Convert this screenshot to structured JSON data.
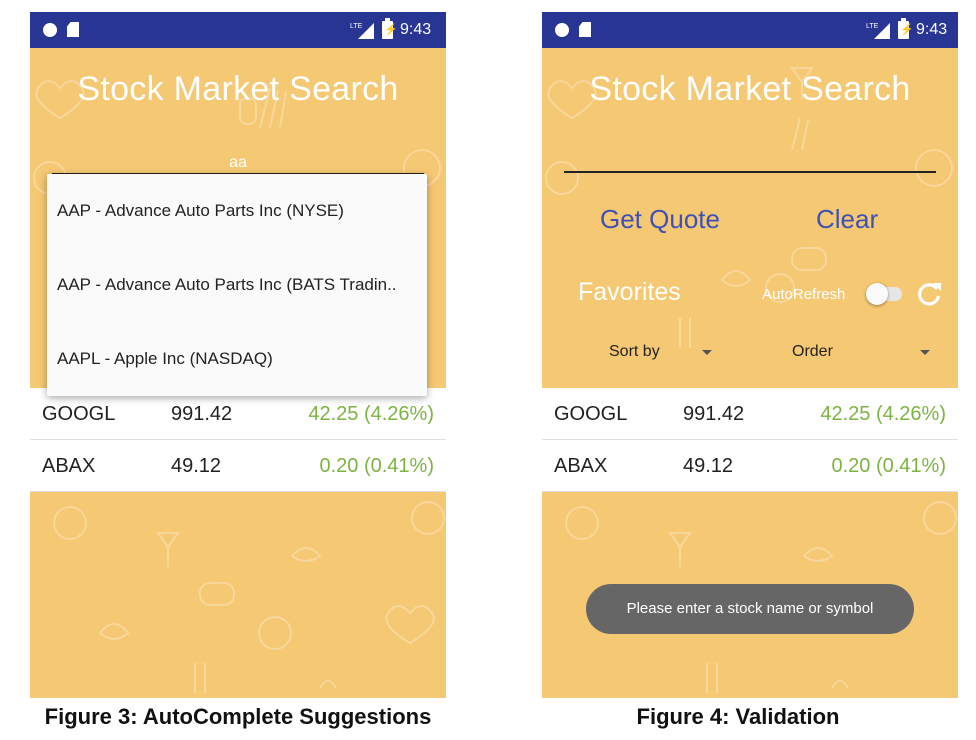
{
  "status_bar": {
    "time": "9:43"
  },
  "figure3": {
    "app_title": "Stock Market Search",
    "typed_text": "aa",
    "suggestions": [
      "AAP - Advance Auto Parts Inc (NYSE)",
      "AAP - Advance Auto Parts Inc (BATS Tradin..",
      "AAPL - Apple Inc (NASDAQ)"
    ],
    "favorites": [
      {
        "symbol": "GOOGL",
        "price": "991.42",
        "change": "42.25 (4.26%)"
      },
      {
        "symbol": "ABAX",
        "price": "49.12",
        "change": "0.20 (0.41%)"
      }
    ],
    "caption": "Figure 3: AutoComplete Suggestions"
  },
  "figure4": {
    "app_title": "Stock Market Search",
    "get_quote_label": "Get Quote",
    "clear_label": "Clear",
    "favorites_label": "Favorites",
    "autorefresh_label": "AutoRefresh",
    "autorefresh_on": false,
    "sort_by_label": "Sort by",
    "order_label": "Order",
    "favorites": [
      {
        "symbol": "GOOGL",
        "price": "991.42",
        "change": "42.25 (4.26%)"
      },
      {
        "symbol": "ABAX",
        "price": "49.12",
        "change": "0.20 (0.41%)"
      }
    ],
    "toast": "Please enter a stock name or symbol",
    "caption": "Figure 4: Validation"
  },
  "colors": {
    "background": "#f5c873",
    "status_bar": "#283593",
    "accent_blue": "#3f51b5",
    "positive_change": "#7cb342",
    "toast": "#666666"
  }
}
